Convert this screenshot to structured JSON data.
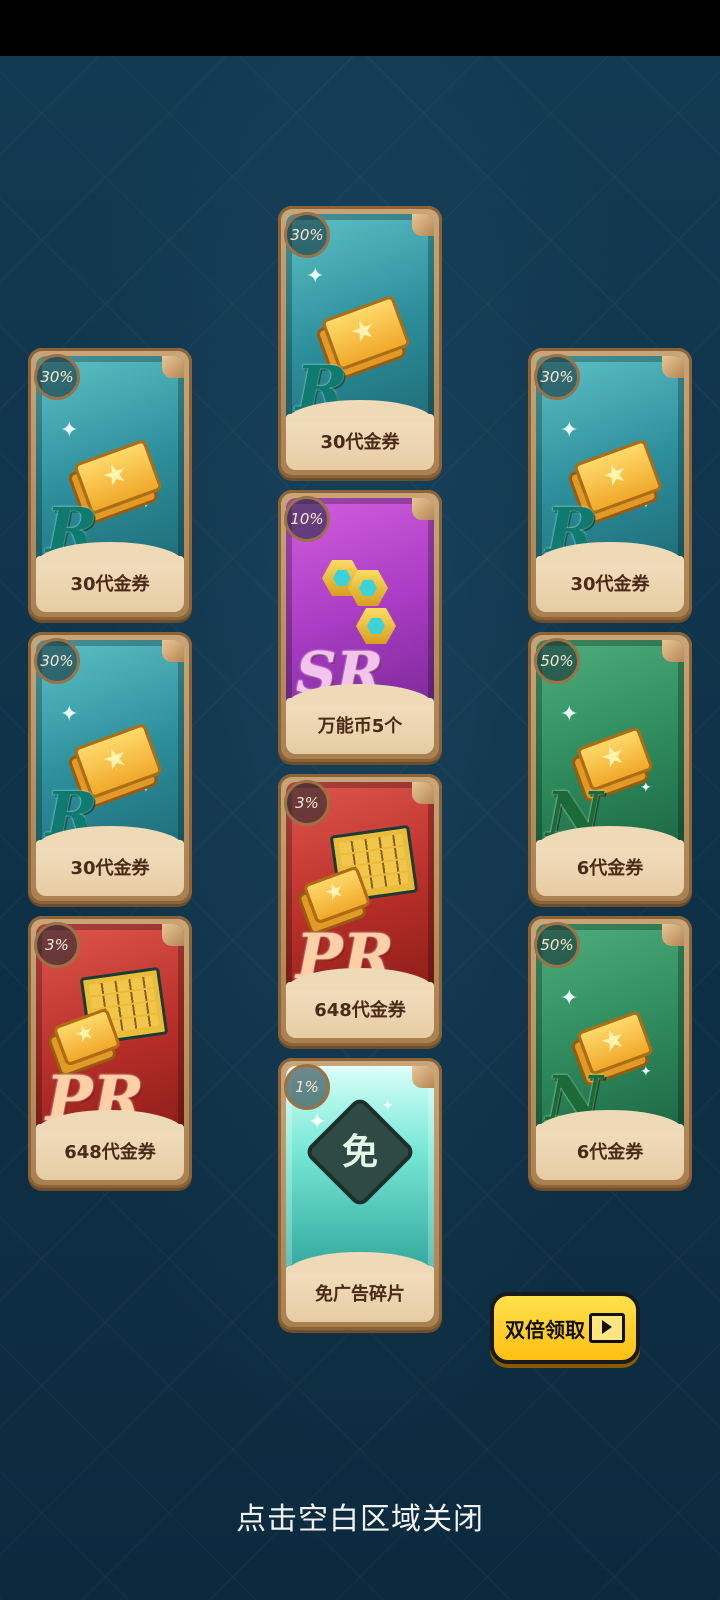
{
  "cards": [
    {
      "id": "c1",
      "percent": "30%",
      "rarity": "R",
      "theme": "R",
      "icon": "ticket-icon",
      "label": "30代金券"
    },
    {
      "id": "c2",
      "percent": "30%",
      "rarity": "R",
      "theme": "R",
      "icon": "ticket-icon",
      "label": "30代金券"
    },
    {
      "id": "c3",
      "percent": "30%",
      "rarity": "R",
      "theme": "R",
      "icon": "ticket-icon",
      "label": "30代金券"
    },
    {
      "id": "c4",
      "percent": "10%",
      "rarity": "SR",
      "theme": "SR",
      "icon": "coin-icon",
      "label": "万能币5个"
    },
    {
      "id": "c5",
      "percent": "30%",
      "rarity": "R",
      "theme": "R",
      "icon": "ticket-icon",
      "label": "30代金券"
    },
    {
      "id": "c6",
      "percent": "50%",
      "rarity": "N",
      "theme": "N",
      "icon": "ticket-icon",
      "label": "6代金券"
    },
    {
      "id": "c7",
      "percent": "3%",
      "rarity": "PR",
      "theme": "PR",
      "icon": "chest-icon",
      "label": "648代金券"
    },
    {
      "id": "c8",
      "percent": "3%",
      "rarity": "PR",
      "theme": "PR",
      "icon": "chest-icon",
      "label": "648代金券"
    },
    {
      "id": "c9",
      "percent": "50%",
      "rarity": "N",
      "theme": "N",
      "icon": "ticket-icon",
      "label": "6代金券"
    },
    {
      "id": "c10",
      "percent": "1%",
      "rarity": "",
      "theme": "AD",
      "icon": "ad-free-piece-icon",
      "label": "免广告碎片",
      "piece_char": "免"
    }
  ],
  "double_button": {
    "label": "双倍领取",
    "icon": "video-icon"
  },
  "close_hint": "点击空白区域关闭"
}
